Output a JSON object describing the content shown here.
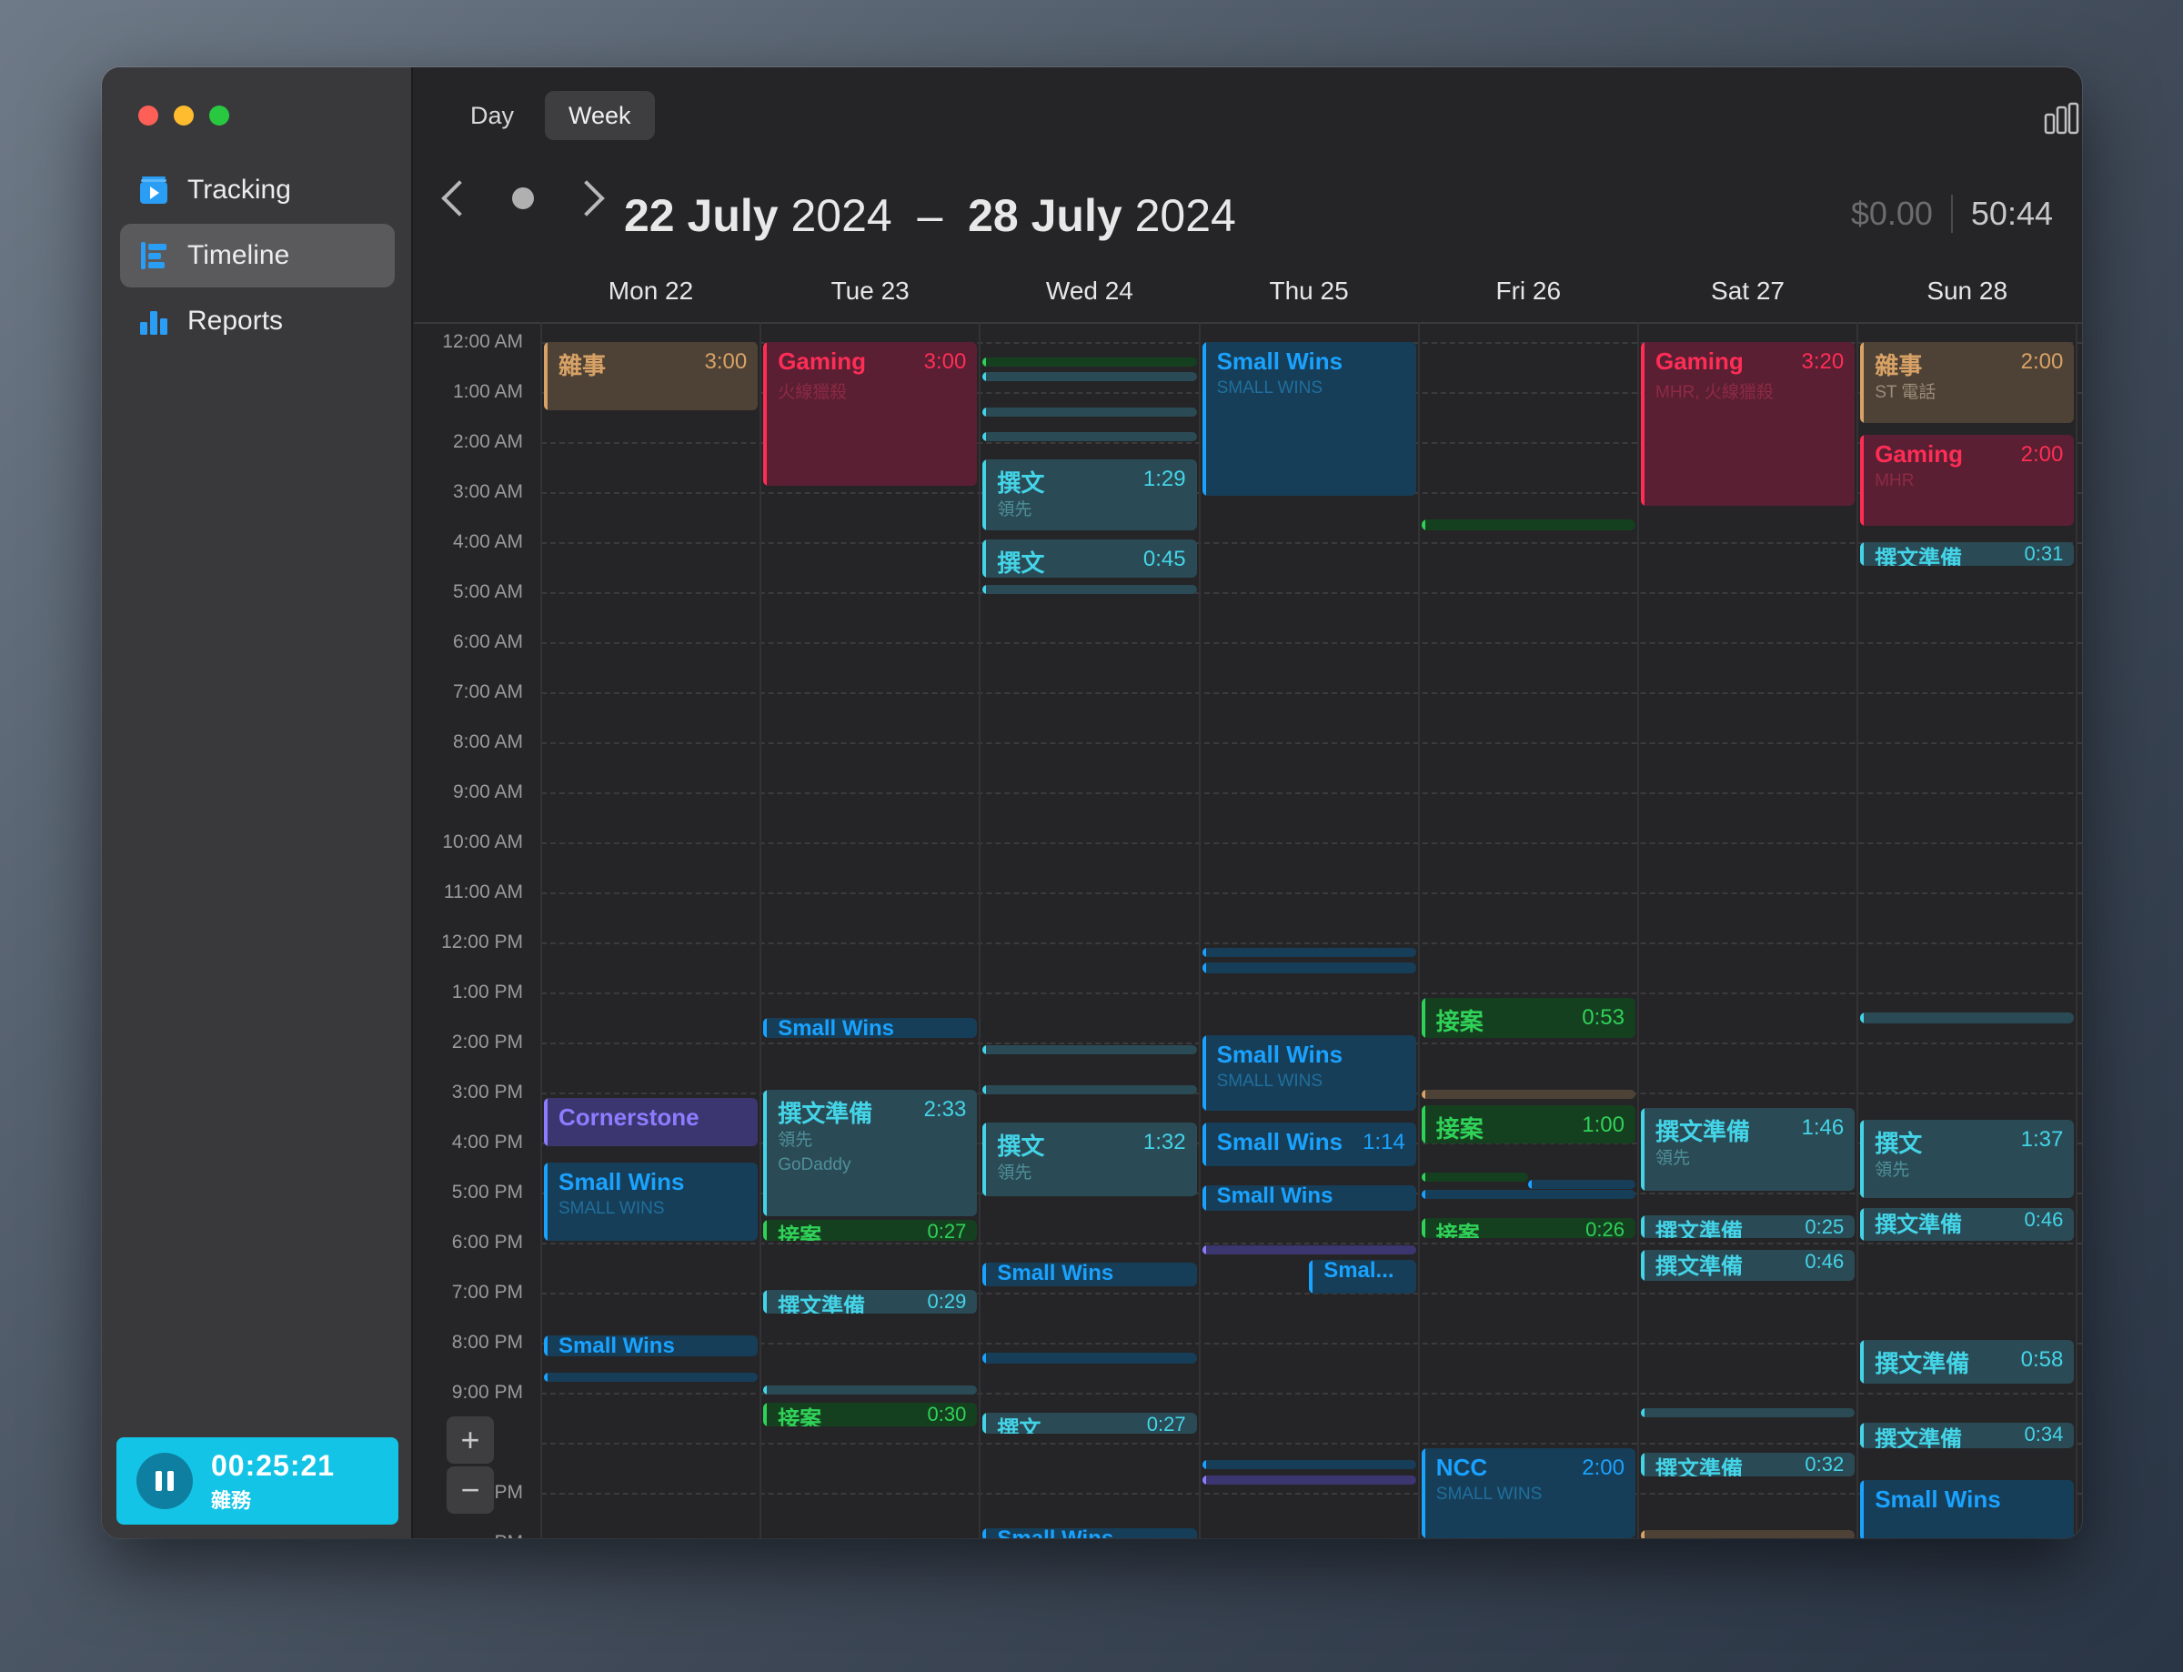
{
  "window": {
    "traffic_lights": [
      "#fe5f57",
      "#febc2e",
      "#28c840"
    ]
  },
  "sidebar": {
    "items": [
      {
        "label": "Tracking",
        "icon": "tracking-icon",
        "selected": false
      },
      {
        "label": "Timeline",
        "icon": "timeline-icon",
        "selected": true
      },
      {
        "label": "Reports",
        "icon": "reports-icon",
        "selected": false
      }
    ],
    "timer": {
      "time": "00:25:21",
      "label": "雜務",
      "icon": "pause-icon"
    }
  },
  "toolbar": {
    "day_label": "Day",
    "week_label": "Week",
    "chart_icon": "bar-chart-icon",
    "share_icon": "share-icon"
  },
  "range": {
    "start_bold": "22 July",
    "start_rest": "2024",
    "dash": "–",
    "end_bold": "28 July",
    "end_rest": "2024"
  },
  "totals": {
    "money": "$0.00",
    "hours": "50:44"
  },
  "days": [
    "Mon 22",
    "Tue 23",
    "Wed 24",
    "Thu 25",
    "Fri 26",
    "Sat 27",
    "Sun 28"
  ],
  "hours": [
    "12:00 AM",
    "1:00 AM",
    "2:00 AM",
    "3:00 AM",
    "4:00 AM",
    "5:00 AM",
    "6:00 AM",
    "7:00 AM",
    "8:00 AM",
    "9:00 AM",
    "10:00 AM",
    "11:00 AM",
    "12:00 PM",
    "1:00 PM",
    "2:00 PM",
    "3:00 PM",
    "4:00 PM",
    "5:00 PM",
    "6:00 PM",
    "7:00 PM",
    "8:00 PM",
    "9:00 PM",
    "",
    "PM",
    "PM"
  ],
  "zoom": {
    "in": "+",
    "out": "−"
  },
  "colors": {
    "chore": "#d8a266",
    "gaming": "#ff2d55",
    "wins": "#1aa2ff",
    "write": "#44d4e8",
    "prep": "#44d4e8",
    "case": "#30d158",
    "cornerstone": "#8e7cff",
    "cornerstone_bg": "#3b3670",
    "ncc": "#1aa2ff"
  },
  "events": [
    {
      "day": 0,
      "start": 0,
      "end": 1.4,
      "title": "雜事",
      "dur": "3:00",
      "sub": "",
      "kind": "chore"
    },
    {
      "day": 0,
      "start": 15.1,
      "end": 16.1,
      "title": "Cornerstone",
      "dur": "",
      "sub": "",
      "kind": "cornerstone"
    },
    {
      "day": 0,
      "start": 16.4,
      "end": 18,
      "title": "Small Wins",
      "dur": "",
      "sub": "SMALL WINS",
      "kind": "wins"
    },
    {
      "day": 0,
      "start": 19.85,
      "end": 20.3,
      "title": "Small Wins",
      "dur": "",
      "sub": "",
      "kind": "wins"
    },
    {
      "day": 0,
      "start": 20.6,
      "end": 20.8,
      "title": "",
      "dur": "",
      "sub": "",
      "kind": "wins"
    },
    {
      "day": 1,
      "start": 0,
      "end": 2.9,
      "title": "Gaming",
      "dur": "3:00",
      "sub": "火線獵殺",
      "kind": "gaming"
    },
    {
      "day": 1,
      "start": 13.5,
      "end": 13.95,
      "title": "Small Wins",
      "dur": "",
      "sub": "",
      "kind": "wins"
    },
    {
      "day": 1,
      "start": 14.95,
      "end": 17.5,
      "title": "撰文準備",
      "dur": "2:33",
      "sub": "領先",
      "sub2": "GoDaddy",
      "kind": "prep"
    },
    {
      "day": 1,
      "start": 17.55,
      "end": 18,
      "title": "接案",
      "dur": "0:27",
      "sub": "",
      "kind": "case"
    },
    {
      "day": 1,
      "start": 18.95,
      "end": 19.45,
      "title": "撰文準備",
      "dur": "0:29",
      "sub": "",
      "kind": "prep"
    },
    {
      "day": 1,
      "start": 20.85,
      "end": 21.05,
      "title": "",
      "dur": "",
      "sub": "",
      "kind": "prep"
    },
    {
      "day": 1,
      "start": 21.2,
      "end": 21.7,
      "title": "接案",
      "dur": "0:30",
      "sub": "",
      "kind": "case"
    },
    {
      "day": 2,
      "start": 0.3,
      "end": 0.5,
      "title": "",
      "dur": "",
      "sub": "",
      "kind": "case"
    },
    {
      "day": 2,
      "start": 0.6,
      "end": 0.8,
      "title": "",
      "dur": "",
      "sub": "",
      "kind": "write"
    },
    {
      "day": 2,
      "start": 1.3,
      "end": 1.5,
      "title": "",
      "dur": "",
      "sub": "",
      "kind": "write"
    },
    {
      "day": 2,
      "start": 1.8,
      "end": 2,
      "title": "",
      "dur": "",
      "sub": "",
      "kind": "write"
    },
    {
      "day": 2,
      "start": 2.35,
      "end": 3.8,
      "title": "撰文",
      "dur": "1:29",
      "sub": "領先",
      "kind": "write"
    },
    {
      "day": 2,
      "start": 3.95,
      "end": 4.75,
      "title": "撰文",
      "dur": "0:45",
      "sub": "",
      "kind": "write"
    },
    {
      "day": 2,
      "start": 4.85,
      "end": 5.05,
      "title": "",
      "dur": "",
      "sub": "",
      "kind": "write"
    },
    {
      "day": 2,
      "start": 14.05,
      "end": 14.25,
      "title": "",
      "dur": "",
      "sub": "",
      "kind": "write"
    },
    {
      "day": 2,
      "start": 14.85,
      "end": 15.05,
      "title": "",
      "dur": "",
      "sub": "",
      "kind": "write"
    },
    {
      "day": 2,
      "start": 15.6,
      "end": 17.1,
      "title": "撰文",
      "dur": "1:32",
      "sub": "領先",
      "kind": "write"
    },
    {
      "day": 2,
      "start": 18.4,
      "end": 18.9,
      "title": "Small Wins",
      "dur": "",
      "sub": "",
      "kind": "wins"
    },
    {
      "day": 2,
      "start": 20.2,
      "end": 20.45,
      "title": "",
      "dur": "",
      "sub": "",
      "kind": "wins"
    },
    {
      "day": 2,
      "start": 21.4,
      "end": 21.85,
      "title": "撰文",
      "dur": "0:27",
      "sub": "",
      "kind": "write"
    },
    {
      "day": 2,
      "start": 23.7,
      "end": 24,
      "title": "Small Wins",
      "dur": "",
      "sub": "",
      "kind": "wins"
    },
    {
      "day": 3,
      "start": 0,
      "end": 3.1,
      "title": "Small Wins",
      "dur": "",
      "sub": "SMALL WINS",
      "kind": "wins"
    },
    {
      "day": 3,
      "start": 12.1,
      "end": 12.3,
      "title": "",
      "dur": "",
      "sub": "",
      "kind": "wins"
    },
    {
      "day": 3,
      "start": 12.4,
      "end": 12.65,
      "title": "",
      "dur": "",
      "sub": "",
      "kind": "wins"
    },
    {
      "day": 3,
      "start": 13.85,
      "end": 15.4,
      "title": "Small Wins",
      "dur": "",
      "sub": "SMALL WINS",
      "kind": "wins"
    },
    {
      "day": 3,
      "start": 15.6,
      "end": 16.5,
      "title": "Small Wins",
      "dur": "1:14",
      "sub": "",
      "kind": "wins"
    },
    {
      "day": 3,
      "start": 16.85,
      "end": 17.4,
      "title": "Small Wins",
      "dur": "",
      "sub": "",
      "kind": "wins"
    },
    {
      "day": 3,
      "start": 18.05,
      "end": 18.25,
      "title": "",
      "dur": "",
      "sub": "",
      "kind": "cornerstone"
    },
    {
      "day": 3,
      "start": 18.35,
      "end": 19.05,
      "title": "Smal...",
      "dur": "",
      "sub": "",
      "kind": "wins",
      "left": 0.5
    },
    {
      "day": 3,
      "start": 22.35,
      "end": 22.55,
      "title": "",
      "dur": "",
      "sub": "",
      "kind": "wins"
    },
    {
      "day": 3,
      "start": 22.65,
      "end": 22.85,
      "title": "",
      "dur": "",
      "sub": "",
      "kind": "cornerstone"
    },
    {
      "day": 4,
      "start": 3.55,
      "end": 3.8,
      "title": "",
      "dur": "",
      "sub": "",
      "kind": "case"
    },
    {
      "day": 4,
      "start": 13.1,
      "end": 13.95,
      "title": "接案",
      "dur": "0:53",
      "sub": "",
      "kind": "case"
    },
    {
      "day": 4,
      "start": 14.95,
      "end": 15.15,
      "title": "",
      "dur": "",
      "sub": "",
      "kind": "chore"
    },
    {
      "day": 4,
      "start": 15.25,
      "end": 16.05,
      "title": "接案",
      "dur": "1:00",
      "sub": "",
      "kind": "case"
    },
    {
      "day": 4,
      "start": 16.6,
      "end": 16.8,
      "title": "",
      "dur": "",
      "sub": "",
      "kind": "case",
      "right": 0.5
    },
    {
      "day": 4,
      "start": 16.75,
      "end": 16.95,
      "title": "",
      "dur": "",
      "sub": "",
      "kind": "wins",
      "left": 0.5
    },
    {
      "day": 4,
      "start": 16.95,
      "end": 17.15,
      "title": "",
      "dur": "",
      "sub": "",
      "kind": "wins"
    },
    {
      "day": 4,
      "start": 17.5,
      "end": 17.95,
      "title": "接案",
      "dur": "0:26",
      "sub": "",
      "kind": "case"
    },
    {
      "day": 4,
      "start": 22.1,
      "end": 23.95,
      "title": "NCC",
      "dur": "2:00",
      "sub": "SMALL WINS",
      "kind": "ncc"
    },
    {
      "day": 5,
      "start": 0,
      "end": 3.3,
      "title": "Gaming",
      "dur": "3:20",
      "sub": "MHR, 火線獵殺",
      "kind": "gaming"
    },
    {
      "day": 5,
      "start": 15.3,
      "end": 17,
      "title": "撰文準備",
      "dur": "1:46",
      "sub": "領先",
      "kind": "prep"
    },
    {
      "day": 5,
      "start": 17.45,
      "end": 17.95,
      "title": "撰文準備",
      "dur": "0:25",
      "sub": "",
      "kind": "prep"
    },
    {
      "day": 5,
      "start": 18.15,
      "end": 18.8,
      "title": "撰文準備",
      "dur": "0:46",
      "sub": "",
      "kind": "prep"
    },
    {
      "day": 5,
      "start": 21.3,
      "end": 21.5,
      "title": "",
      "dur": "",
      "sub": "",
      "kind": "prep"
    },
    {
      "day": 5,
      "start": 22.2,
      "end": 22.7,
      "title": "撰文準備",
      "dur": "0:32",
      "sub": "",
      "kind": "prep"
    },
    {
      "day": 5,
      "start": 23.75,
      "end": 24,
      "title": "",
      "dur": "",
      "sub": "",
      "kind": "chore"
    },
    {
      "day": 6,
      "start": 0,
      "end": 1.65,
      "title": "雜事",
      "dur": "2:00",
      "sub": "ST 電話",
      "kind": "chore"
    },
    {
      "day": 6,
      "start": 1.85,
      "end": 3.7,
      "title": "Gaming",
      "dur": "2:00",
      "sub": "MHR",
      "kind": "gaming"
    },
    {
      "day": 6,
      "start": 4,
      "end": 4.5,
      "title": "撰文準備",
      "dur": "0:31",
      "sub": "",
      "kind": "prep"
    },
    {
      "day": 6,
      "start": 13.4,
      "end": 13.65,
      "title": "",
      "dur": "",
      "sub": "",
      "kind": "prep"
    },
    {
      "day": 6,
      "start": 15.55,
      "end": 17.15,
      "title": "撰文",
      "dur": "1:37",
      "sub": "領先",
      "kind": "write"
    },
    {
      "day": 6,
      "start": 17.3,
      "end": 18,
      "title": "撰文準備",
      "dur": "0:46",
      "sub": "",
      "kind": "prep"
    },
    {
      "day": 6,
      "start": 19.95,
      "end": 20.85,
      "title": "撰文準備",
      "dur": "0:58",
      "sub": "",
      "kind": "prep"
    },
    {
      "day": 6,
      "start": 21.6,
      "end": 22.15,
      "title": "撰文準備",
      "dur": "0:34",
      "sub": "",
      "kind": "prep"
    },
    {
      "day": 6,
      "start": 22.75,
      "end": 24,
      "title": "Small Wins",
      "dur": "",
      "sub": "",
      "kind": "wins"
    }
  ]
}
